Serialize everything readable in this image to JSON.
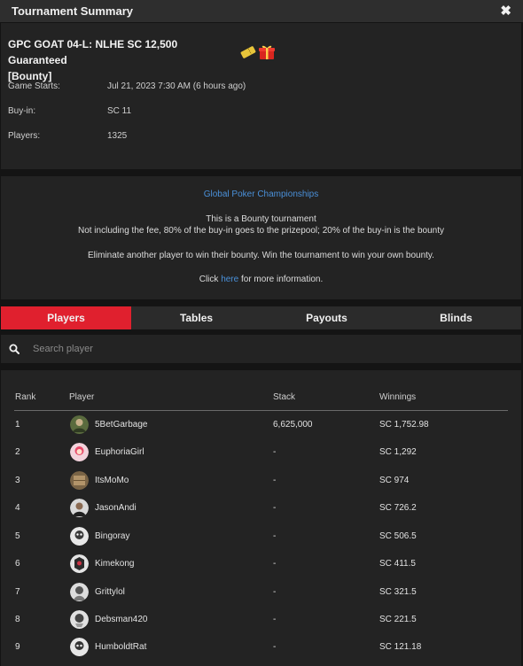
{
  "header": {
    "title": "Tournament Summary",
    "close_icon": "close-icon"
  },
  "tournament": {
    "name_line1": "GPC GOAT 04-L: NLHE SC 12,500 Guaranteed",
    "name_line2": "[Bounty]",
    "icons": [
      "ticket-icon",
      "gift-icon"
    ],
    "details": [
      {
        "label": "Game Starts:",
        "value": "Jul 21, 2023 7:30 AM (6 hours ago)"
      },
      {
        "label": "Buy-in:",
        "value": "SC 11"
      },
      {
        "label": "Players:",
        "value": "1325"
      }
    ]
  },
  "description": {
    "series_link": "Global Poker Championships",
    "line1": "This is a Bounty tournament",
    "line2": "Not including the fee, 80% of the buy-in goes to the prizepool; 20% of the buy-in is the bounty",
    "line3": "Eliminate another player to win their bounty. Win the tournament to win your own bounty.",
    "click_prefix": "Click ",
    "click_link": "here",
    "click_suffix": " for more information."
  },
  "tabs": [
    {
      "label": "Players",
      "active": true
    },
    {
      "label": "Tables",
      "active": false
    },
    {
      "label": "Payouts",
      "active": false
    },
    {
      "label": "Blinds",
      "active": false
    }
  ],
  "search": {
    "placeholder": "Search player",
    "value": "",
    "icon": "search-icon"
  },
  "table": {
    "columns": [
      "Rank",
      "Player",
      "Stack",
      "Winnings"
    ],
    "rows": [
      {
        "rank": "1",
        "player": "5BetGarbage",
        "stack": "6,625,000",
        "winnings": "SC 1,752.98"
      },
      {
        "rank": "2",
        "player": "EuphoriaGirl",
        "stack": "-",
        "winnings": "SC 1,292"
      },
      {
        "rank": "3",
        "player": "ItsMoMo",
        "stack": "-",
        "winnings": "SC 974"
      },
      {
        "rank": "4",
        "player": "JasonAndi",
        "stack": "-",
        "winnings": "SC 726.2"
      },
      {
        "rank": "5",
        "player": "Bingoray",
        "stack": "-",
        "winnings": "SC 506.5"
      },
      {
        "rank": "6",
        "player": "Kimekong",
        "stack": "-",
        "winnings": "SC 411.5"
      },
      {
        "rank": "7",
        "player": "Grittylol",
        "stack": "-",
        "winnings": "SC 321.5"
      },
      {
        "rank": "8",
        "player": "Debsman420",
        "stack": "-",
        "winnings": "SC 221.5"
      },
      {
        "rank": "9",
        "player": "HumboldtRat",
        "stack": "-",
        "winnings": "SC 121.18"
      }
    ]
  },
  "colors": {
    "accent": "#e0202e",
    "link": "#4a90d9",
    "background": "#141414",
    "panel": "#232323"
  }
}
